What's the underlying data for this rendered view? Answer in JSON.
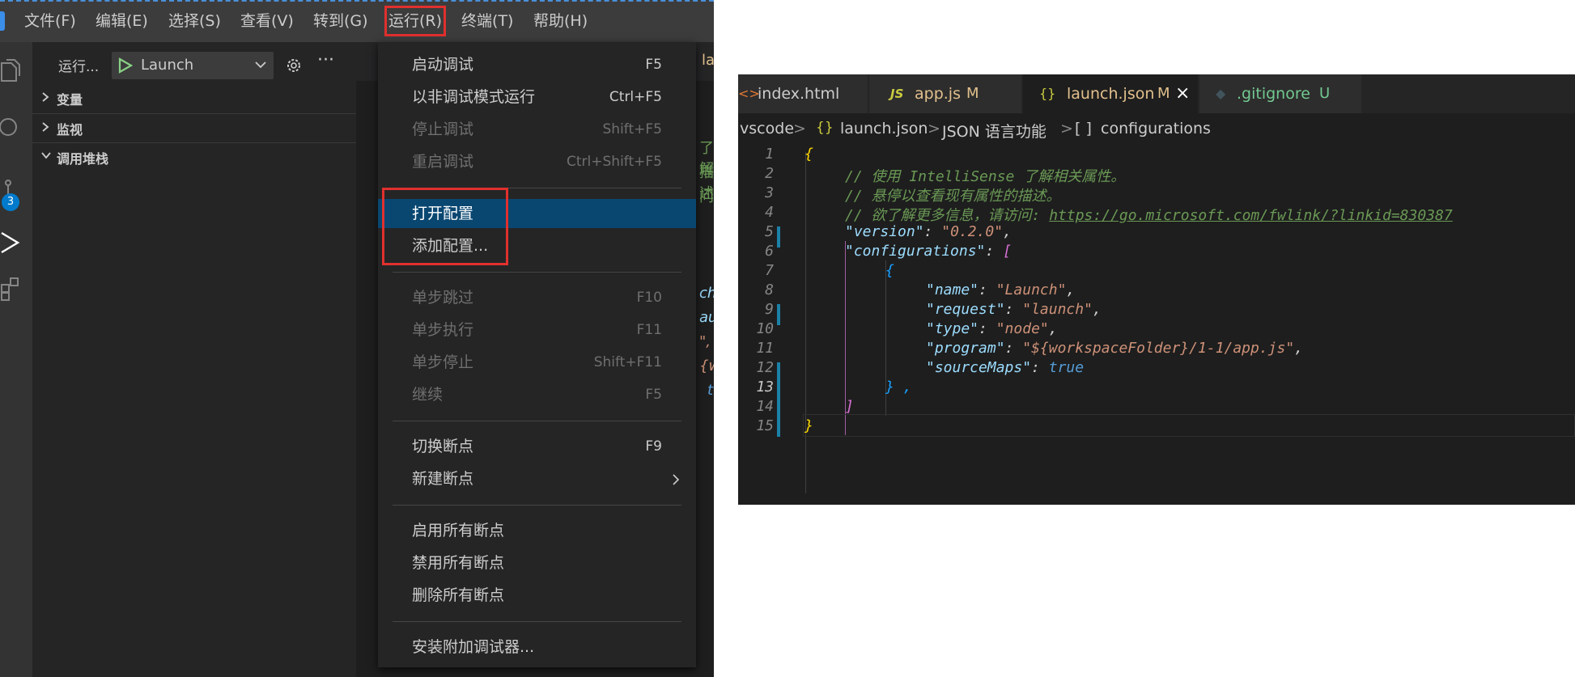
{
  "left_window": {
    "menubar": {
      "items": [
        "文件(F)",
        "编辑(E)",
        "选择(S)",
        "查看(V)",
        "转到(G)",
        "运行(R)",
        "终端(T)",
        "帮助(H)"
      ],
      "active_item": "运行(R)"
    },
    "activity_bar": {
      "source_control_badge": "3"
    },
    "debug_toolbar": {
      "run_label": "运行...",
      "configuration": "Launch"
    },
    "sidebar_sections": [
      "变量",
      "监视",
      "调用堆栈"
    ],
    "editor_strip": {
      "tab_fragment": "la",
      "text_fragments": [
        "了解",
        "描述",
        "问:",
        "ch",
        "au",
        "\",",
        "{w",
        "t"
      ]
    },
    "run_menu": {
      "groups": [
        [
          {
            "label": "启动调试",
            "key": "F5",
            "disabled": false
          },
          {
            "label": "以非调试模式运行",
            "key": "Ctrl+F5",
            "disabled": false
          },
          {
            "label": "停止调试",
            "key": "Shift+F5",
            "disabled": true
          },
          {
            "label": "重启调试",
            "key": "Ctrl+Shift+F5",
            "disabled": true
          }
        ],
        [
          {
            "label": "打开配置",
            "key": "",
            "disabled": false,
            "selected": true
          },
          {
            "label": "添加配置...",
            "key": "",
            "disabled": false
          }
        ],
        [
          {
            "label": "单步跳过",
            "key": "F10",
            "disabled": true
          },
          {
            "label": "单步执行",
            "key": "F11",
            "disabled": true
          },
          {
            "label": "单步停止",
            "key": "Shift+F11",
            "disabled": true
          },
          {
            "label": "继续",
            "key": "F5",
            "disabled": true
          }
        ],
        [
          {
            "label": "切换断点",
            "key": "F9",
            "disabled": false
          },
          {
            "label": "新建断点",
            "key": "",
            "disabled": false,
            "submenu": true
          }
        ],
        [
          {
            "label": "启用所有断点",
            "key": "",
            "disabled": false
          },
          {
            "label": "禁用所有断点",
            "key": "",
            "disabled": false
          },
          {
            "label": "删除所有断点",
            "key": "",
            "disabled": false
          }
        ],
        [
          {
            "label": "安装附加调试器...",
            "key": "",
            "disabled": false
          }
        ]
      ]
    }
  },
  "right_editor": {
    "tabs": [
      {
        "icon": "<>",
        "name": "index.html",
        "status": "",
        "icon_color": "#e37933",
        "name_color": "#cccccc"
      },
      {
        "icon": "JS",
        "name": "app.js",
        "status": "M",
        "icon_color": "#cbcb41",
        "name_color": "#e2c08d"
      },
      {
        "icon": "{}",
        "name": "launch.json",
        "status": "M",
        "icon_color": "#cbcb41",
        "name_color": "#e2c08d",
        "active": true,
        "close": "×"
      },
      {
        "icon": "◆",
        "name": ".gitignore",
        "status": "U",
        "icon_color": "#41535b",
        "name_color": "#73c991"
      }
    ],
    "breadcrumb": [
      ".vscode",
      ">",
      "{}",
      "launch.json",
      ">",
      "JSON 语言功能",
      ">",
      "[ ]",
      "configurations"
    ],
    "line_numbers": [
      "1",
      "2",
      "3",
      "4",
      "5",
      "6",
      "7",
      "8",
      "9",
      "10",
      "11",
      "12",
      "13",
      "14",
      "15"
    ],
    "code": {
      "l1": "{",
      "l2": "// 使用 IntelliSense 了解相关属性。",
      "l3": "// 悬停以查看现有属性的描述。",
      "l4_prefix": "// 欲了解更多信息，请访问: ",
      "l4_link": "https://go.microsoft.com/fwlink/?linkid=830387",
      "version_key": "\"version\"",
      "version_val": "\"0.2.0\"",
      "configurations_key": "\"configurations\"",
      "l7": "{",
      "name_key": "\"name\"",
      "name_val": "\"Launch\"",
      "request_key": "\"request\"",
      "request_val": "\"launch\"",
      "type_key": "\"type\"",
      "type_val": "\"node\"",
      "program_key": "\"program\"",
      "program_val": "\"${workspaceFolder}/1-1/app.js\"",
      "sourcemaps_key": "\"sourceMaps\"",
      "sourcemaps_val": "true",
      "l13": "} ,",
      "l14": "]",
      "l15": "}"
    }
  }
}
